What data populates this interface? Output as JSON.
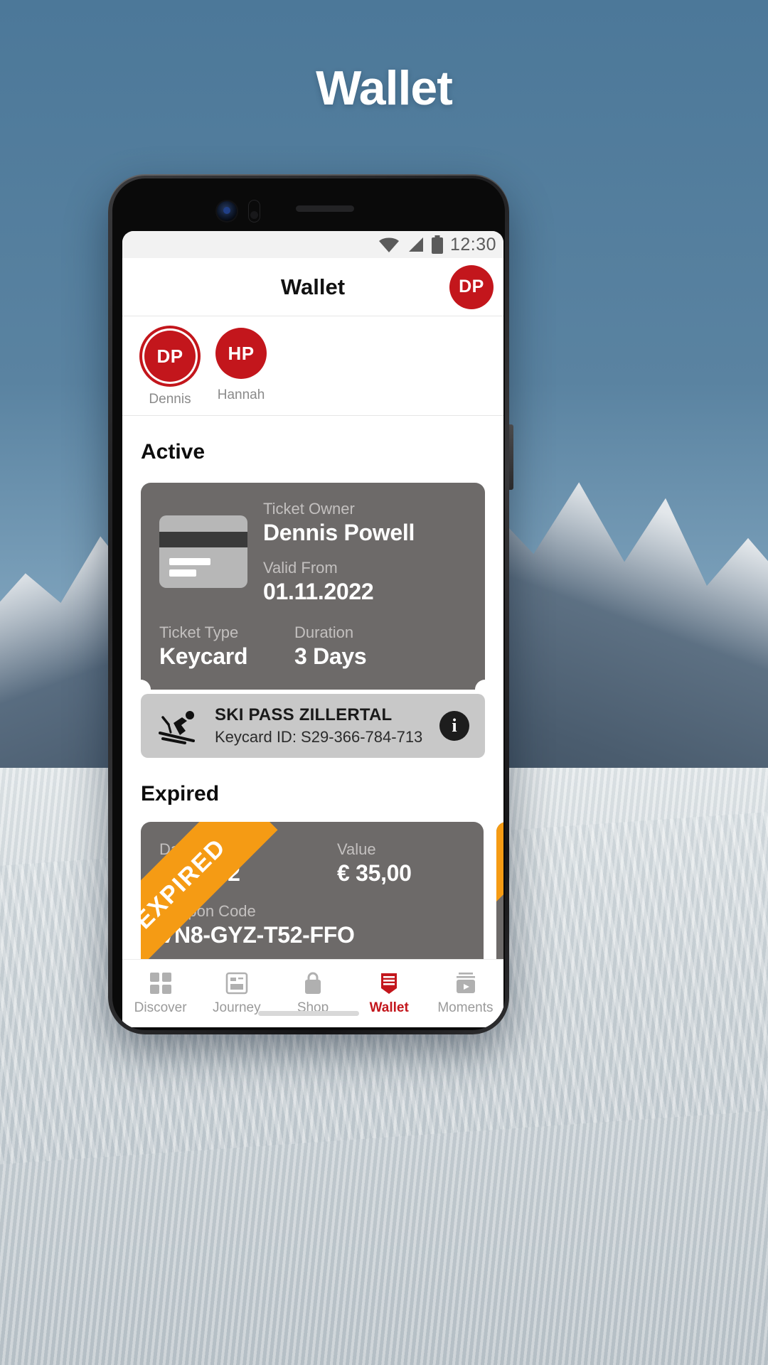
{
  "page": {
    "title": "Wallet"
  },
  "statusbar": {
    "wifi_icon": "wifi-icon",
    "signal_icon": "cellular-signal-icon",
    "battery_icon": "battery-full-icon",
    "time": "12:30"
  },
  "appbar": {
    "title": "Wallet",
    "avatar_initials": "DP"
  },
  "profiles": [
    {
      "initials": "DP",
      "name": "Dennis",
      "selected": true
    },
    {
      "initials": "HP",
      "name": "Hannah",
      "selected": false
    }
  ],
  "sections": {
    "active_title": "Active",
    "expired_title": "Expired"
  },
  "active_ticket": {
    "owner_label": "Ticket Owner",
    "owner_value": "Dennis Powell",
    "valid_from_label": "Valid From",
    "valid_from_value": "01.11.2022",
    "type_label": "Ticket Type",
    "type_value": "Keycard",
    "duration_label": "Duration",
    "duration_value": "3 Days",
    "footer_title": "SKI PASS ZILLERTAL",
    "footer_subtitle": "Keycard ID: S29-366-784-713",
    "info_label": "i",
    "card_icon": "keycard-icon",
    "ski_icon": "skier-icon"
  },
  "expired_tickets": [
    {
      "ribbon": "EXPIRED",
      "date_label": "Date",
      "date_value": "02.2022",
      "value_label": "Value",
      "value_value": "€ 35,00",
      "coupon_label": "Coupon Code",
      "coupon_value": "VN8-GYZ-T52-FFO"
    }
  ],
  "bottom_nav": [
    {
      "label": "Discover",
      "icon": "grid-icon",
      "active": false
    },
    {
      "label": "Journey",
      "icon": "article-icon",
      "active": false
    },
    {
      "label": "Shop",
      "icon": "shopping-bag-icon",
      "active": false
    },
    {
      "label": "Wallet",
      "icon": "wallet-icon",
      "active": true
    },
    {
      "label": "Moments",
      "icon": "video-library-icon",
      "active": false
    }
  ],
  "colors": {
    "brand_red": "#c3161c",
    "card_gray": "#6d6a69",
    "ribbon_orange": "#f59b14",
    "footer_gray": "#c8c8c8"
  }
}
